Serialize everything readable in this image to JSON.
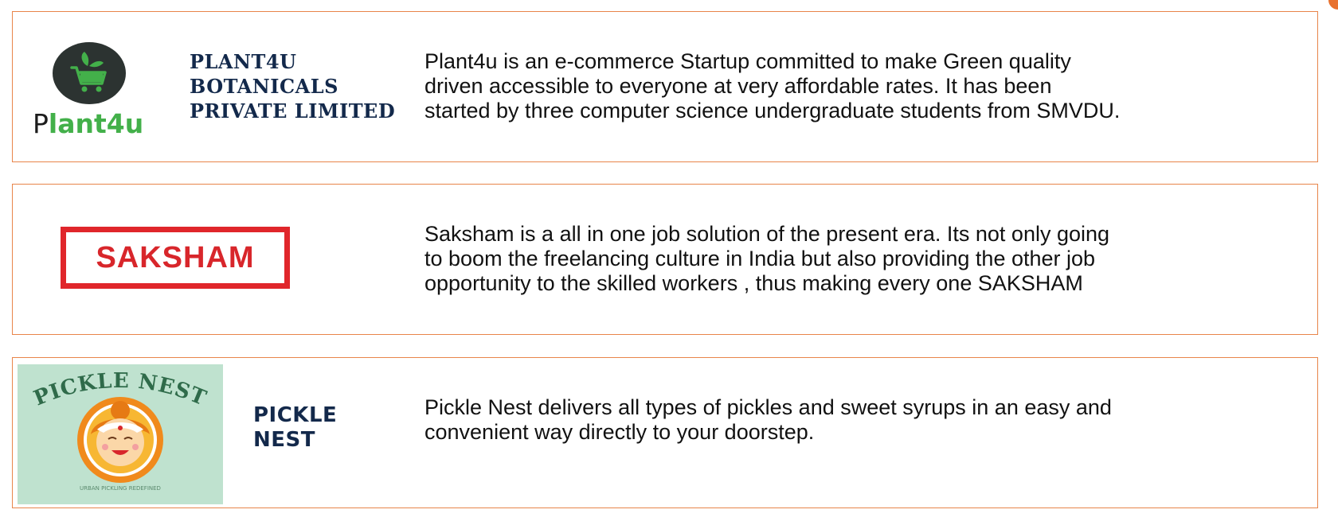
{
  "cards": [
    {
      "name": "PLANT4U\nBOTANICALS\nPRIVATE LIMITED",
      "description": "Plant4u is an e-commerce Startup committed to make Green quality\ndriven accessible to everyone at very affordable rates. It has been\nstarted by three computer science undergraduate students from SMVDU.",
      "logo": {
        "text_dark": "P",
        "text_green": "lant4u",
        "icon": "shopping-cart-leaf-icon"
      }
    },
    {
      "name": "",
      "description": "Saksham is a all in one job solution of the present era. Its not only going\nto boom the freelancing culture in India but also providing the other job\nopportunity to the skilled workers , thus making every one SAKSHAM",
      "logo": {
        "text": "SAKSHAM"
      }
    },
    {
      "name": "PICKLE\nNEST",
      "description": "Pickle Nest delivers all types of pickles and sweet syrups in an easy and\nconvenient way directly to your doorstep.",
      "logo": {
        "title": "PICKLE NEST",
        "tagline": "URBAN PICKLING REDEFINED"
      }
    }
  ],
  "colors": {
    "border": "#e8854a",
    "name_text": "#13294b",
    "plant_green": "#43b04a",
    "saksham_red": "#e0262b",
    "pickle_bg": "#bfe2cf"
  }
}
